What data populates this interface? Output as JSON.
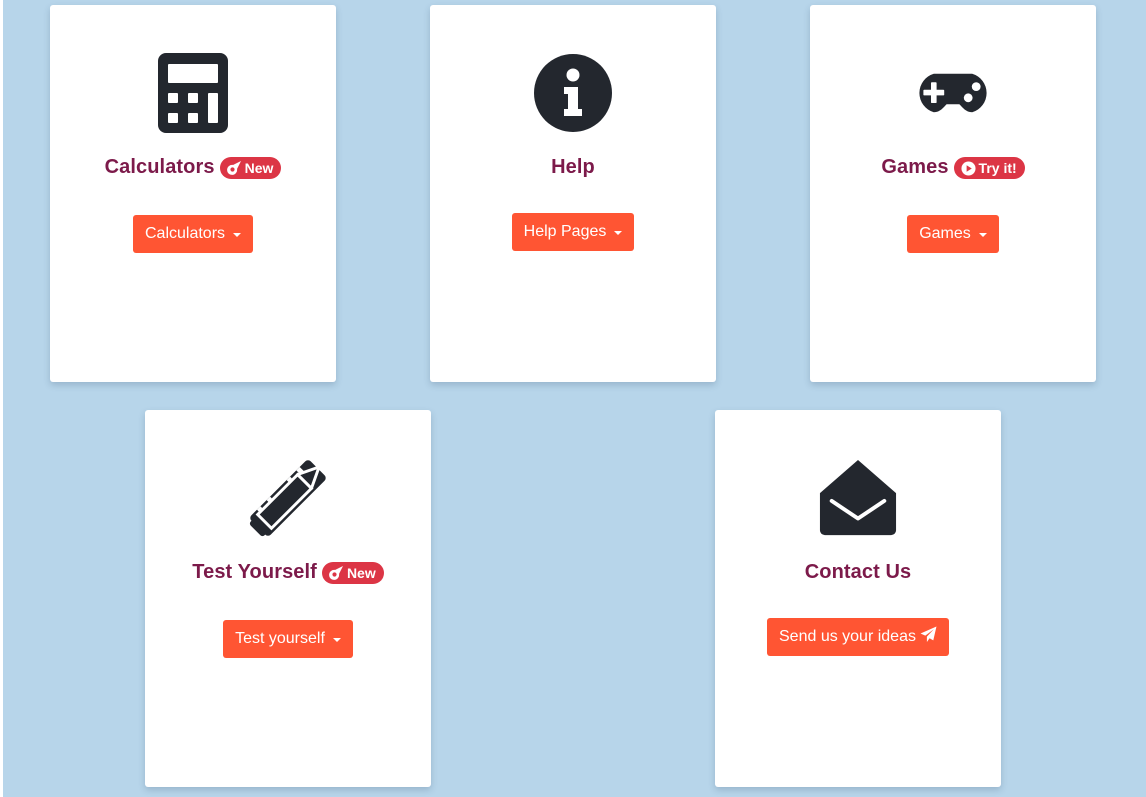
{
  "colors": {
    "background": "#b7d5ea",
    "card": "#ffffff",
    "title": "#7c1a4a",
    "button": "#ff5533",
    "badge": "#dc3545",
    "icon": "#23272e"
  },
  "cards": [
    {
      "title": "Calculators",
      "icon": "calculator-icon",
      "badge": {
        "label": "New",
        "icon": "meteor-icon"
      },
      "button": {
        "label": "Calculators",
        "icon": "caret-down-icon"
      }
    },
    {
      "title": "Help",
      "icon": "info-circle-icon",
      "button": {
        "label": "Help Pages",
        "icon": "caret-down-icon"
      }
    },
    {
      "title": "Games",
      "icon": "gamepad-icon",
      "badge": {
        "label": "Try it!",
        "icon": "play-circle-icon"
      },
      "button": {
        "label": "Games",
        "icon": "caret-down-icon"
      }
    },
    {
      "title": "Test Yourself",
      "icon": "pencil-ruler-icon",
      "badge": {
        "label": "New",
        "icon": "meteor-icon"
      },
      "button": {
        "label": "Test yourself",
        "icon": "caret-down-icon"
      }
    },
    {
      "title": "Contact Us",
      "icon": "envelope-open-icon",
      "button": {
        "label": "Send us your ideas",
        "icon": "paper-plane-icon"
      }
    }
  ]
}
